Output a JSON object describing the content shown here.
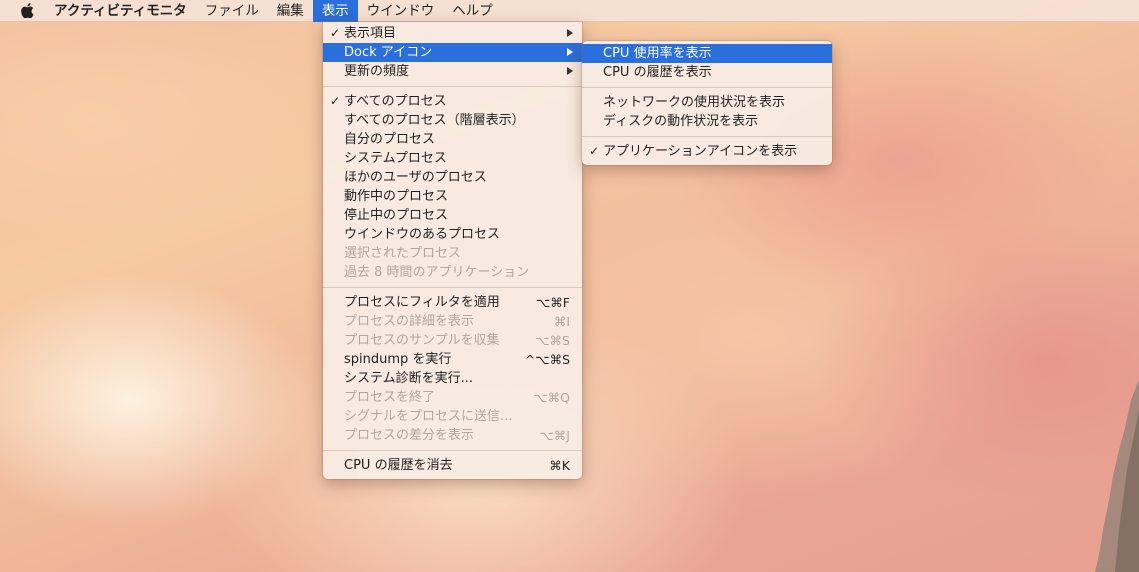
{
  "menubar": {
    "apple_icon": "apple-logo-icon",
    "app_name": "アクティビティモニタ",
    "items": [
      "ファイル",
      "編集",
      "表示",
      "ウインドウ",
      "ヘルプ"
    ],
    "active_index": 2
  },
  "view_menu": {
    "items": [
      {
        "label": "表示項目",
        "checked": true,
        "submenu": true
      },
      {
        "label": "Dock アイコン",
        "submenu": true,
        "highlighted": true
      },
      {
        "label": "更新の頻度",
        "submenu": true
      },
      {
        "label": "すべてのプロセス",
        "checked": true
      },
      {
        "label": "すべてのプロセス（階層表示）"
      },
      {
        "label": "自分のプロセス"
      },
      {
        "label": "システムプロセス"
      },
      {
        "label": "ほかのユーザのプロセス"
      },
      {
        "label": "動作中のプロセス"
      },
      {
        "label": "停止中のプロセス"
      },
      {
        "label": "ウインドウのあるプロセス"
      },
      {
        "label": "選択されたプロセス",
        "disabled": true
      },
      {
        "label": "過去 8 時間のアプリケーション",
        "disabled": true
      },
      {
        "label": "プロセスにフィルタを適用",
        "shortcut": "⌥⌘F"
      },
      {
        "label": "プロセスの詳細を表示",
        "shortcut": "⌘I",
        "disabled": true
      },
      {
        "label": "プロセスのサンプルを収集",
        "shortcut": "⌥⌘S",
        "disabled": true
      },
      {
        "label": "spindump を実行",
        "shortcut": "^⌥⌘S"
      },
      {
        "label": "システム診断を実行..."
      },
      {
        "label": "プロセスを終了",
        "shortcut": "⌥⌘Q",
        "disabled": true
      },
      {
        "label": "シグナルをプロセスに送信...",
        "disabled": true
      },
      {
        "label": "プロセスの差分を表示",
        "shortcut": "⌥⌘J",
        "disabled": true
      },
      {
        "label": "CPU の履歴を消去",
        "shortcut": "⌘K"
      }
    ]
  },
  "dock_submenu": {
    "items": [
      {
        "label": "CPU 使用率を表示",
        "highlighted": true
      },
      {
        "label": "CPU の履歴を表示"
      },
      {
        "label": "ネットワークの使用状況を表示"
      },
      {
        "label": "ディスクの動作状況を表示"
      },
      {
        "label": "アプリケーションアイコンを表示",
        "checked": true
      }
    ]
  },
  "symbols": {
    "checkmark": "✓"
  },
  "colors": {
    "highlight": "#2a6fdb",
    "disabled_text": "#b2a6a0"
  }
}
